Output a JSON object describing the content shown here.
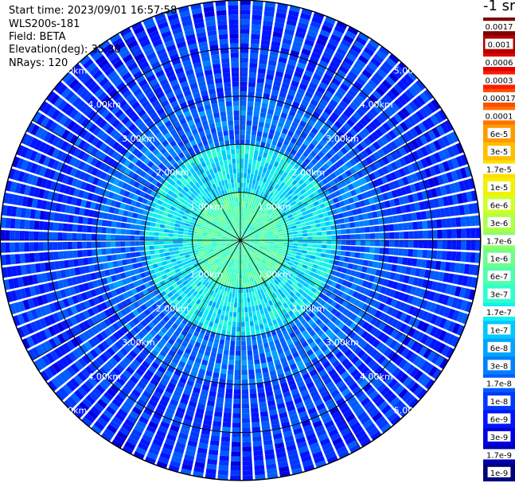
{
  "header": {
    "start_time": "Start time: 2023/09/01 16:57:58",
    "instrument": "WLS200s-181",
    "field": "Field: BETA",
    "elevation": "Elevation(deg): 35.30",
    "nrays": "NRays: 120"
  },
  "colorbar": {
    "title": "-1 sr",
    "labels": [
      "0.0017",
      "0.001",
      "0.0006",
      "0.0003",
      "0.00017",
      "0.0001",
      "6e-5",
      "3e-5",
      "1.7e-5",
      "1e-5",
      "6e-6",
      "3e-6",
      "1.7e-6",
      "1e-6",
      "6e-7",
      "3e-7",
      "1.7e-7",
      "1e-7",
      "6e-8",
      "3e-8",
      "1.7e-8",
      "1e-8",
      "6e-9",
      "3e-9",
      "1.7e-9",
      "1e-9"
    ],
    "colors": [
      "#7f0000",
      "#b40000",
      "#e00000",
      "#ff1a00",
      "#ff4d00",
      "#ff7300",
      "#ff9a00",
      "#ffbd00",
      "#ffde00",
      "#f2f200",
      "#d0ff2a",
      "#b0ff48",
      "#8cff6a",
      "#6dff8a",
      "#4cffac",
      "#2effcc",
      "#12f0ee",
      "#00c8ff",
      "#00a4ff",
      "#0080ff",
      "#005cff",
      "#0038ff",
      "#0014ff",
      "#0000e0",
      "#0000b0",
      "#000080"
    ]
  },
  "chart_data": {
    "type": "heatmap",
    "subtype": "polar-ppi",
    "field": "BETA",
    "units": "sr-1",
    "elevation_deg": 35.3,
    "n_rays": 120,
    "range_rings_km": [
      1,
      2,
      3,
      4,
      5
    ],
    "ring_labels": {
      "1": "1.00km",
      "2": "2.00km",
      "3": "3.00km",
      "4": "4.00km",
      "5": "5.00km"
    },
    "max_range_km": 5.0,
    "spoke_angles_deg": [
      0,
      30,
      60,
      90,
      120,
      150,
      180,
      210,
      240,
      270,
      300,
      330
    ],
    "value_pattern": [
      {
        "range_km": [
          0,
          1
        ],
        "log10_beta": -6.3
      },
      {
        "range_km": [
          1,
          2
        ],
        "log10_beta": -6.8
      },
      {
        "range_km": [
          2,
          3
        ],
        "log10_beta": -7.6
      },
      {
        "range_km": [
          3,
          4
        ],
        "log10_beta": -7.9
      },
      {
        "range_km": [
          4,
          5
        ],
        "log10_beta": -8.0
      }
    ],
    "colorscale": "jet-log",
    "vmin_log10": -9,
    "vmax_log10": -2.77
  }
}
